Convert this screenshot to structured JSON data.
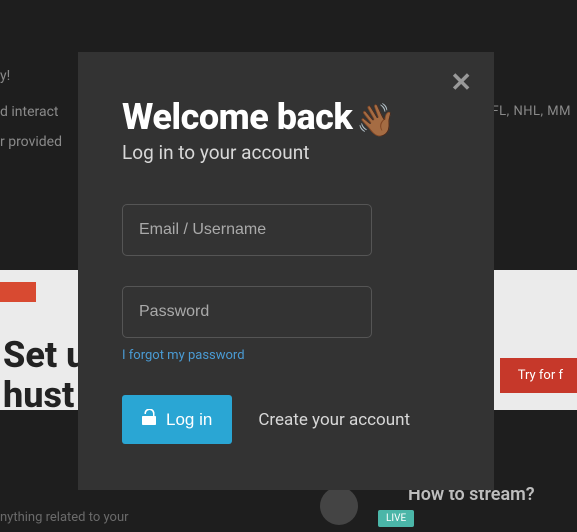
{
  "modal": {
    "title": "Welcome back",
    "wave_emoji": "👋🏾",
    "subtitle": "Log in to your account",
    "email_placeholder": "Email / Username",
    "password_placeholder": "Password",
    "forgot_label": "I forgot my password",
    "login_label": "Log in",
    "create_label": "Create your account",
    "close_symbol": "✕"
  },
  "background": {
    "text_day": "y!",
    "text_interact": "d interact",
    "text_leagues": "FL, NHL, MM",
    "text_provided": "r provided",
    "button_orange": "",
    "headline_line1": "Set u",
    "headline_line2": "hust",
    "try_button": "Try for f",
    "stream_question": "How to stream?",
    "related_text": "nything related to your",
    "badge_text": "LIVE"
  }
}
